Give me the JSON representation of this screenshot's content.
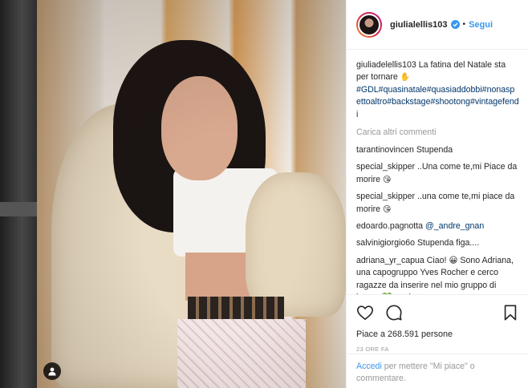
{
  "post": {
    "username": "giulialellis103",
    "follow_separator": "•",
    "follow_label": "Segui",
    "caption": {
      "author": "giuliadelellis103",
      "text": "La fatina del Natale sta per tornare",
      "emoji": "✋",
      "hashtags": "#GDL#quasinatale#quasiaddobbi#nonaspettoaltro#backstage#shootong#vintagefendi"
    },
    "load_more": "Carica altri commenti",
    "comments": [
      {
        "user": "tarantinovincen",
        "text": "Stupenda",
        "emoji": ""
      },
      {
        "user": "special_skipper",
        "text": "..Una come te,mi Piace da morire",
        "emoji": "😘"
      },
      {
        "user": "special_skipper",
        "text": "..una come te,mi piace da morire",
        "emoji": "😘"
      },
      {
        "user": "edoardo.pagnotta",
        "text": "",
        "mention": "@_andre_gnan",
        "emoji": ""
      },
      {
        "user": "salvinigiorgio6o",
        "text": "Stupenda figa....",
        "emoji": ""
      },
      {
        "user": "adriana_yr_capua",
        "text": "Ciao! 😀 Sono Adriana, una capogruppo Yves Rocher e cerco ragazze da inserire nel mio gruppo di lavoro 💚 studentesse, mamme, casalinghe che cercano un guadagno extra lavorando da casa 🌸",
        "emoji": ""
      }
    ],
    "likes": "Piace a 268.591 persone",
    "timestamp": "23 ORE FA",
    "login_prompt": {
      "link": "Accedi",
      "rest": " per mettere \"Mi piace\" o commentare."
    }
  },
  "icons": {
    "like": "heart-icon",
    "comment": "comment-bubble-icon",
    "save": "bookmark-icon",
    "tag": "user-tag-icon",
    "verified": "verified-badge-icon"
  },
  "colors": {
    "link": "#3897f0",
    "hashtag": "#003569",
    "muted": "#999999"
  }
}
